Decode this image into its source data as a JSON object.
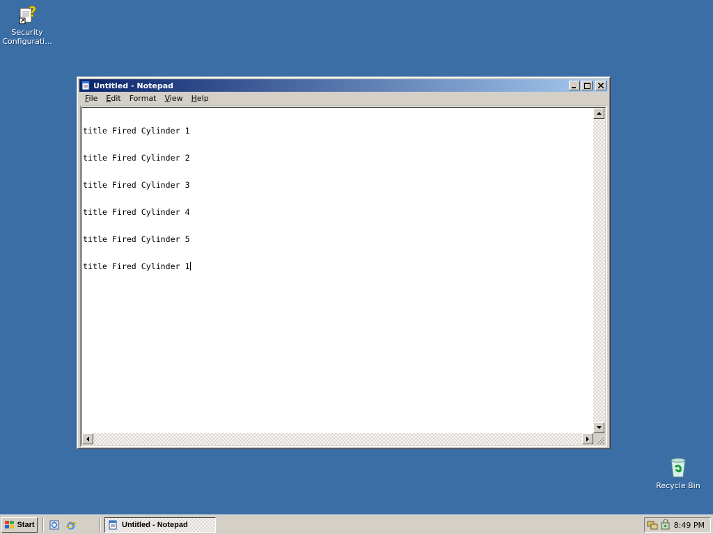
{
  "desktop": {
    "icons": [
      {
        "label": "Security Configurati...",
        "icon": "security-config-icon"
      },
      {
        "label": "Recycle Bin",
        "icon": "recycle-bin-icon"
      }
    ],
    "background_color": "#3a6ea5"
  },
  "window": {
    "title": "Untitled - Notepad",
    "controls": {
      "minimize": "minimize-icon",
      "maximize": "maximize-icon",
      "close": "close-icon"
    },
    "menu": [
      {
        "key": "F",
        "rest": "ile"
      },
      {
        "key": "E",
        "rest": "dit"
      },
      {
        "key": "F",
        "rest": "ormat",
        "pre": ""
      },
      {
        "key": "V",
        "rest": "iew"
      },
      {
        "key": "H",
        "rest": "elp"
      }
    ],
    "content_lines": [
      "title Fired Cylinder 1",
      "title Fired Cylinder 2",
      "title Fired Cylinder 3",
      "title Fired Cylinder 4",
      "title Fired Cylinder 5",
      "title Fired Cylinder 1"
    ]
  },
  "taskbar": {
    "start_label": "Start",
    "quick_launch": [
      "server-manager-icon",
      "internet-explorer-icon"
    ],
    "task_button": "Untitled - Notepad",
    "tray_icons": [
      "network-icon",
      "security-icon"
    ],
    "clock": "8:49 PM"
  },
  "colors": {
    "title_active_start": "#0a246a",
    "title_active_end": "#a6caf0",
    "face": "#d4d0c8"
  }
}
